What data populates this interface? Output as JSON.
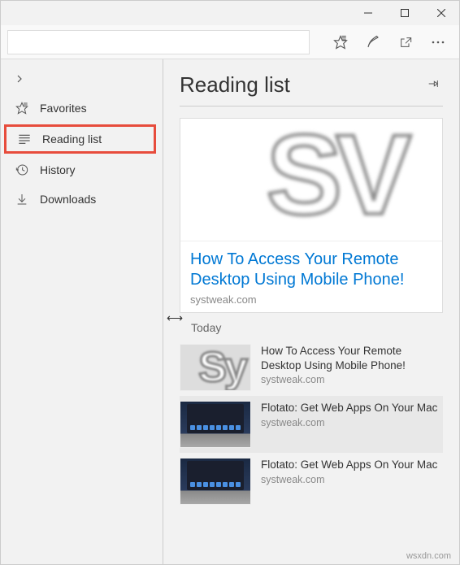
{
  "sidebar": {
    "items": [
      {
        "label": "Favorites"
      },
      {
        "label": "Reading list"
      },
      {
        "label": "History"
      },
      {
        "label": "Downloads"
      }
    ]
  },
  "main": {
    "title": "Reading list",
    "featured": {
      "title": "How To Access Your Remote Desktop Using Mobile Phone!",
      "source": "systweak.com"
    },
    "section": "Today",
    "items": [
      {
        "title": "How To Access Your Remote Desktop Using Mobile Phone!",
        "source": "systweak.com",
        "thumb": "sy"
      },
      {
        "title": "Flotato: Get Web Apps On Your Mac",
        "source": "systweak.com",
        "thumb": "laptop",
        "highlighted": true
      },
      {
        "title": "Flotato: Get Web Apps On Your Mac",
        "source": "systweak.com",
        "thumb": "laptop"
      }
    ]
  },
  "watermark": "wsxdn.com"
}
